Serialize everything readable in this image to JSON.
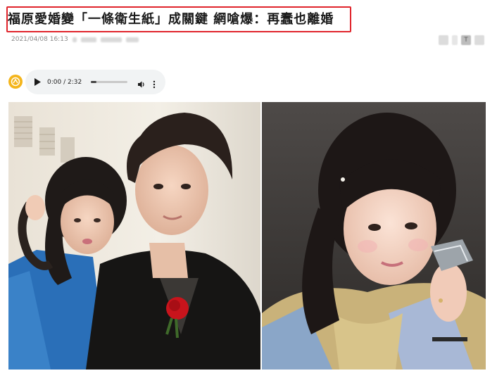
{
  "article": {
    "title": "福原愛婚變「一條衛生紙」成關鍵 網嗆爆：再蠢也離婚",
    "timestamp": "2021/04/08 16:13"
  },
  "audio_player": {
    "time_display": "0:00 / 2:32",
    "progress": 0.0,
    "buffered": 0.15,
    "play_icon": "play-icon",
    "volume_icon": "volume-icon",
    "more_icon": "more-options-icon"
  },
  "toolbar": {
    "icons": [
      "share-icon",
      "font-size-icon",
      "bookmark-icon"
    ],
    "font_size_label": "T"
  },
  "colors": {
    "highlight_border": "#e0242b",
    "logo": "#f4b51c",
    "player_bg": "#f1f3f4"
  }
}
